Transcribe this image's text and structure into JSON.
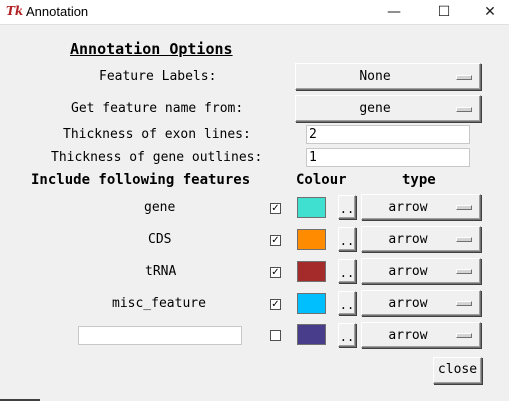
{
  "window": {
    "title": "Annotation",
    "icon_glyph": "Tk",
    "minimize_glyph": "—",
    "maximize_glyph": "☐",
    "close_glyph": "✕"
  },
  "heading": "Annotation Options",
  "feature_labels": {
    "label": "Feature Labels:",
    "value": "None"
  },
  "feature_name": {
    "label": "Get feature name from:",
    "value": "gene"
  },
  "exon_thickness": {
    "label": "Thickness of exon lines:",
    "value": "2"
  },
  "gene_thickness": {
    "label": "Thickness of gene outlines:",
    "value": "1"
  },
  "columns": {
    "features": "Include following features",
    "colour": "Colour",
    "type": "type"
  },
  "features": [
    {
      "name": "gene",
      "checked": "✓",
      "color": "#40e0d0",
      "dots": "..",
      "type": "arrow"
    },
    {
      "name": "CDS",
      "checked": "✓",
      "color": "#ff8c00",
      "dots": "..",
      "type": "arrow"
    },
    {
      "name": "tRNA",
      "checked": "✓",
      "color": "#a52a2a",
      "dots": "..",
      "type": "arrow"
    },
    {
      "name": "misc_feature",
      "checked": "✓",
      "color": "#00bfff",
      "dots": "..",
      "type": "arrow"
    },
    {
      "name": "",
      "checked": "",
      "color": "#483d8b",
      "dots": "..",
      "type": "arrow"
    }
  ],
  "close_label": "close"
}
